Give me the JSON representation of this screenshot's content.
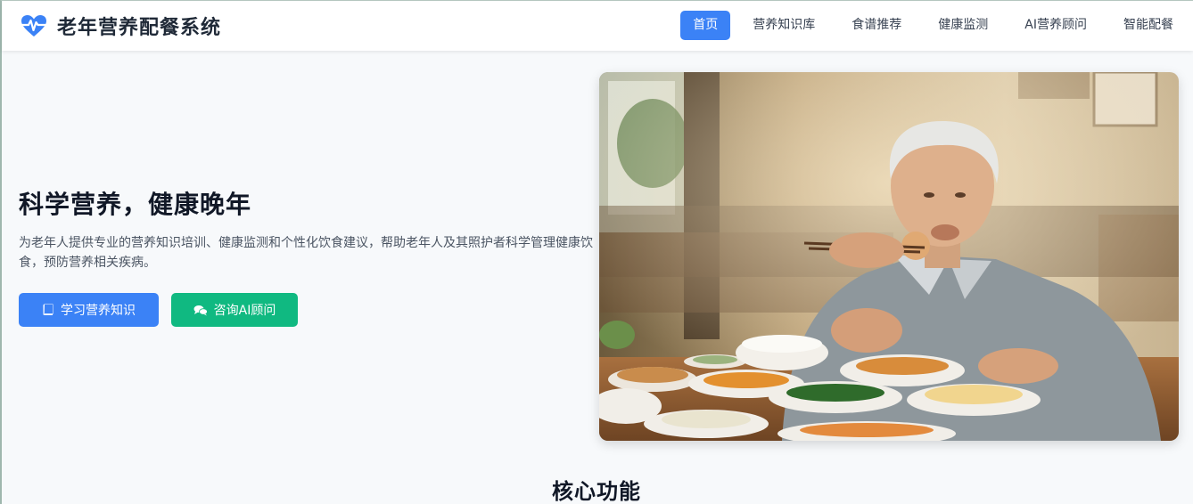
{
  "brand": {
    "title": "老年营养配餐系统",
    "icon": "heart-pulse-icon",
    "color": "#3b82f6"
  },
  "nav": {
    "items": [
      {
        "label": "首页",
        "active": true
      },
      {
        "label": "营养知识库",
        "active": false
      },
      {
        "label": "食谱推荐",
        "active": false
      },
      {
        "label": "健康监测",
        "active": false
      },
      {
        "label": "AI营养顾问",
        "active": false
      },
      {
        "label": "智能配餐",
        "active": false
      }
    ]
  },
  "hero": {
    "title": "科学营养，健康晚年",
    "description": "为老年人提供专业的营养知识培训、健康监测和个性化饮食建议，帮助老年人及其照护者科学管理健康饮食，预防营养相关疾病。",
    "buttons": [
      {
        "label": "学习营养知识",
        "icon": "book-icon",
        "color": "#3b82f6"
      },
      {
        "label": "咨询AI顾问",
        "icon": "chat-icon",
        "color": "#10b981"
      }
    ],
    "image": {
      "subject": "elderly-man-dining-photo"
    }
  },
  "section": {
    "title": "核心功能"
  }
}
